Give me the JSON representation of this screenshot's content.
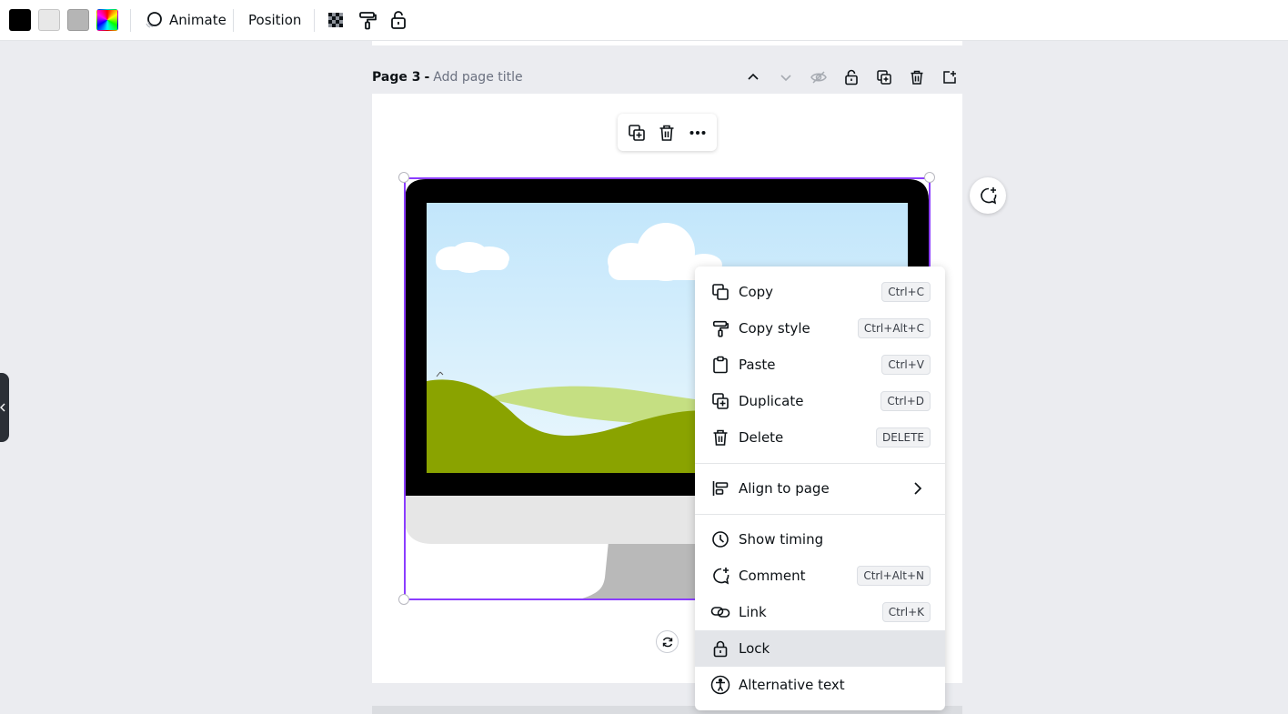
{
  "toolbar": {
    "swatches": [
      {
        "name": "black",
        "color": "#000000"
      },
      {
        "name": "light-gray",
        "color": "#e8e8e8"
      },
      {
        "name": "gray",
        "color": "#b5b5b5"
      }
    ],
    "animate_label": "Animate",
    "position_label": "Position",
    "icons": [
      "transparency-icon",
      "paint-roller-icon",
      "lock-open-icon"
    ]
  },
  "page": {
    "label": "Page 3",
    "separator": "-",
    "title_placeholder": "Add page title",
    "actions": [
      "chevron-up-icon",
      "chevron-down-icon",
      "hide-icon",
      "lock-icon",
      "duplicate-page-icon",
      "delete-page-icon",
      "add-page-icon"
    ]
  },
  "element_toolbar": {
    "icons": [
      "duplicate-icon",
      "trash-icon",
      "more-icon"
    ]
  },
  "context_menu": {
    "groups": [
      [
        {
          "label": "Copy",
          "shortcut": "Ctrl+C",
          "icon": "copy-icon"
        },
        {
          "label": "Copy style",
          "shortcut": "Ctrl+Alt+C",
          "icon": "paint-roller-icon"
        },
        {
          "label": "Paste",
          "shortcut": "Ctrl+V",
          "icon": "clipboard-icon"
        },
        {
          "label": "Duplicate",
          "shortcut": "Ctrl+D",
          "icon": "duplicate-icon"
        },
        {
          "label": "Delete",
          "shortcut": "DELETE",
          "icon": "trash-icon"
        }
      ],
      [
        {
          "label": "Align to page",
          "icon": "align-left-icon",
          "submenu": true
        }
      ],
      [
        {
          "label": "Show timing",
          "icon": "clock-icon"
        },
        {
          "label": "Comment",
          "shortcut": "Ctrl+Alt+N",
          "icon": "comment-add-icon"
        },
        {
          "label": "Link",
          "shortcut": "Ctrl+K",
          "icon": "link-icon"
        },
        {
          "label": "Lock",
          "icon": "lock-icon",
          "highlighted": true
        },
        {
          "label": "Alternative text",
          "icon": "accessibility-icon"
        }
      ]
    ]
  },
  "colors": {
    "selection": "#8b3dff",
    "canvas_bg": "#ebecf0",
    "menu_highlight": "#e3e5e9"
  }
}
